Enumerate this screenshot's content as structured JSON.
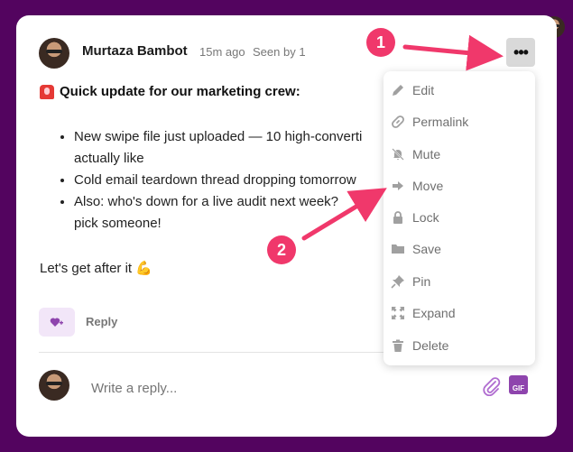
{
  "post": {
    "author": "Murtaza Bambot",
    "time": "15m ago",
    "seen": "Seen by 1",
    "title": "Quick update for our marketing crew:",
    "bullets": [
      {
        "line1": "New swipe file just uploaded — 10 high-converti",
        "line2": "actually like"
      },
      {
        "line1": "Cold email teardown thread dropping tomorrow",
        "line2": ""
      },
      {
        "line1": "Also: who's down for a live audit next week?",
        "line2": "pick someone!"
      }
    ],
    "signoff": "Let's get after it 💪",
    "reply_label": "Reply"
  },
  "reply_box": {
    "placeholder": "Write a reply..."
  },
  "gif_label": "GIF",
  "menu": {
    "items": [
      {
        "label": "Edit",
        "icon": "pencil-icon"
      },
      {
        "label": "Permalink",
        "icon": "link-icon"
      },
      {
        "label": "Mute",
        "icon": "bell-slash-icon"
      },
      {
        "label": "Move",
        "icon": "arrow-right-icon"
      },
      {
        "label": "Lock",
        "icon": "lock-icon"
      },
      {
        "label": "Save",
        "icon": "folder-icon"
      },
      {
        "label": "Pin",
        "icon": "pin-icon"
      },
      {
        "label": "Expand",
        "icon": "expand-icon"
      },
      {
        "label": "Delete",
        "icon": "trash-icon"
      }
    ]
  },
  "annotations": {
    "step1": "1",
    "step2": "2"
  },
  "colors": {
    "background": "#53045f",
    "accent": "#f0386b",
    "gif": "#8e44ad"
  }
}
